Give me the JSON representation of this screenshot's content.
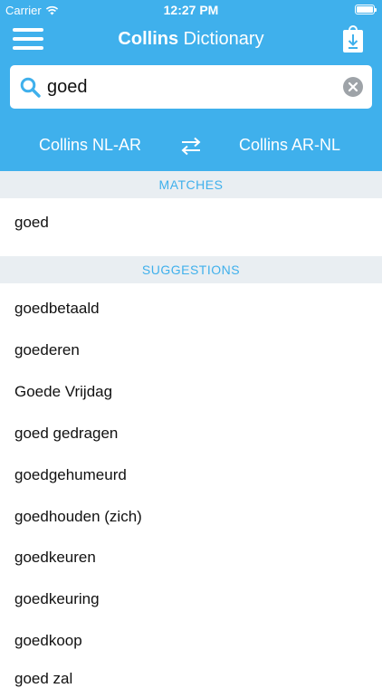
{
  "status_bar": {
    "carrier": "Carrier",
    "time": "12:27 PM"
  },
  "nav": {
    "title_brand": "Collins",
    "title_rest": " Dictionary"
  },
  "search": {
    "value": "goed"
  },
  "dictionaries": {
    "left": "Collins NL-AR",
    "right": "Collins AR-NL"
  },
  "sections": {
    "matches": "MATCHES",
    "suggestions": "SUGGESTIONS"
  },
  "matches": [
    "goed"
  ],
  "suggestions": [
    "goedbetaald",
    "goederen",
    "Goede Vrijdag",
    "goed gedragen",
    "goedgehumeurd",
    "goedhouden (zich)",
    "goedkeuren",
    "goedkeuring",
    "goedkoop",
    "goed zal"
  ],
  "icons": {
    "menu": "hamburger-menu-icon",
    "download": "download-bag-icon",
    "search": "magnifier-icon",
    "clear": "clear-x-icon",
    "swap": "swap-arrows-icon",
    "wifi": "wifi-icon",
    "battery": "battery-icon"
  },
  "colors": {
    "accent": "#3fb0ec",
    "section_bg": "#e9eef2",
    "clear_button": "#9ea3a8"
  }
}
